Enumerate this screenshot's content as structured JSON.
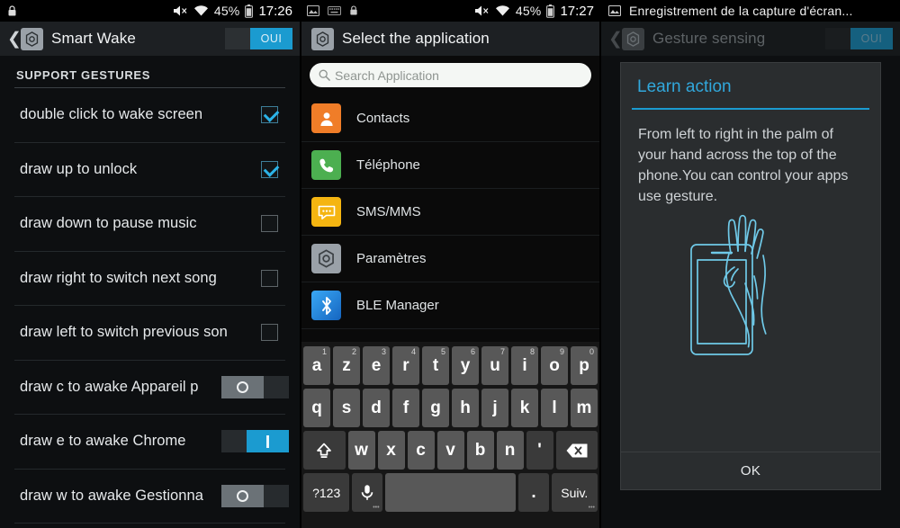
{
  "panel1": {
    "statusbar": {
      "left_icons": [
        "lock-icon"
      ],
      "mute_icon": "volume-mute-icon",
      "wifi_icon": "wifi-icon",
      "battery_text": "45%",
      "battery_icon": "battery-icon",
      "time": "17:26"
    },
    "appbar": {
      "back_icon": "back-caret-icon",
      "app_icon": "settings-gear-icon",
      "title": "Smart Wake",
      "toggle_label": "OUI",
      "toggle_state": "on"
    },
    "section_title": "SUPPORT GESTURES",
    "rows": [
      {
        "label": "double click to wake screen",
        "control": "checkbox",
        "state": "checked"
      },
      {
        "label": "draw up to unlock",
        "control": "checkbox",
        "state": "checked"
      },
      {
        "label": "draw down to pause music",
        "control": "checkbox",
        "state": "unchecked"
      },
      {
        "label": "draw right to switch next song",
        "control": "checkbox",
        "state": "unchecked"
      },
      {
        "label": "draw left to switch previous son",
        "control": "checkbox",
        "state": "unchecked"
      },
      {
        "label": "draw c to awake Appareil p",
        "control": "toggle",
        "state": "off",
        "thumb": "O"
      },
      {
        "label": "draw e to awake Chrome",
        "control": "toggle",
        "state": "on",
        "thumb": "I"
      },
      {
        "label": "draw w to awake Gestionna",
        "control": "toggle",
        "state": "off",
        "thumb": "O"
      }
    ]
  },
  "panel2": {
    "statusbar": {
      "left_icons": [
        "image-icon",
        "keyboard-icon",
        "lock-icon"
      ],
      "mute_icon": "volume-mute-icon",
      "wifi_icon": "wifi-icon",
      "battery_text": "45%",
      "time": "17:27"
    },
    "appbar": {
      "app_icon": "settings-gear-icon",
      "title": "Select the application"
    },
    "search": {
      "icon": "search-icon",
      "placeholder": "Search Application",
      "value": ""
    },
    "apps": [
      {
        "name": "Contacts",
        "icon": "contacts-icon",
        "color": "#f07d28"
      },
      {
        "name": "Téléphone",
        "icon": "phone-icon",
        "color": "#4caf50"
      },
      {
        "name": "SMS/MMS",
        "icon": "sms-icon",
        "color": "#f5b511"
      },
      {
        "name": "Paramètres",
        "icon": "settings-gear-icon",
        "color": "#9aa1a8"
      },
      {
        "name": "BLE Manager",
        "icon": "bluetooth-icon",
        "color": "#2196f3"
      }
    ],
    "keyboard": {
      "row1": [
        {
          "key": "a",
          "sup": "1"
        },
        {
          "key": "z",
          "sup": "2"
        },
        {
          "key": "e",
          "sup": "3"
        },
        {
          "key": "r",
          "sup": "4"
        },
        {
          "key": "t",
          "sup": "5"
        },
        {
          "key": "y",
          "sup": "6"
        },
        {
          "key": "u",
          "sup": "7"
        },
        {
          "key": "i",
          "sup": "8"
        },
        {
          "key": "o",
          "sup": "9"
        },
        {
          "key": "p",
          "sup": "0"
        }
      ],
      "row2": [
        "q",
        "s",
        "d",
        "f",
        "g",
        "h",
        "j",
        "k",
        "l",
        "m"
      ],
      "row3_shift": "shift-icon",
      "row3": [
        "w",
        "x",
        "c",
        "v",
        "b",
        "n",
        "'"
      ],
      "row3_backspace": "backspace-icon",
      "row4_symbols": "?123",
      "row4_mic": "microphone-icon",
      "row4_space": "",
      "row4_period": ".",
      "row4_next": "Suiv."
    }
  },
  "panel3": {
    "statusbar": {
      "notification_icon": "image-icon",
      "notification_text": "Enregistrement de la capture d'écran..."
    },
    "appbar": {
      "back_icon": "back-caret-icon",
      "app_icon": "settings-gear-icon",
      "title": "Gesture sensing",
      "toggle_label": "OUI",
      "toggle_state": "on"
    },
    "dialog": {
      "title": "Learn action",
      "body": "From left to right in the palm of your hand across the top of the phone.You can control your apps use gesture.",
      "illustration": "hand-over-phone-illustration",
      "ok_label": "OK"
    }
  },
  "colors": {
    "accent_blue": "#1b9bd0",
    "title_blue": "#31a8dc",
    "panel_bg": "#0d0f11",
    "appbar_bg": "#1d2023",
    "dialog_bg": "#2a2d2f"
  }
}
